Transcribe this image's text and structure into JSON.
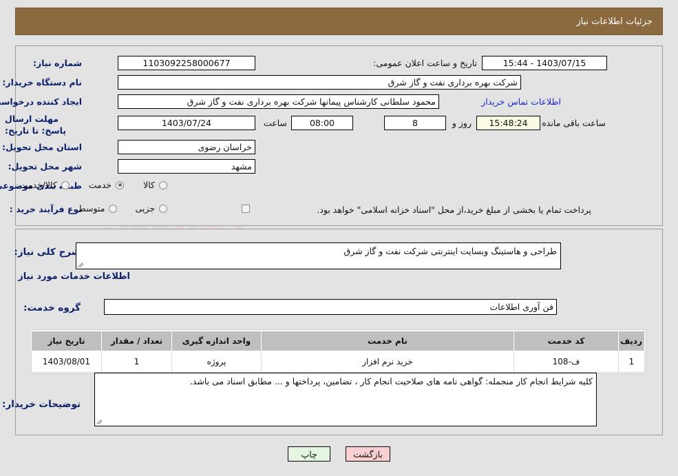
{
  "header": {
    "title": "جزئیات اطلاعات نیاز",
    "bar_color": "#8a6a3e"
  },
  "summary": {
    "need_number_label": "شماره نیاز:",
    "need_number_value": "1103092258000677",
    "announce_datetime_label": "تاریخ و ساعت اعلان عمومی:",
    "announce_datetime_value": "1403/07/15 - 15:44",
    "buyer_org_label": "نام دستگاه خریدار:",
    "buyer_org_value": "شرکت بهره برداری نفت و گاز شرق",
    "requester_label": "ایجاد کننده درخواست:",
    "requester_value": "محمود سلطانی کارشناس پیمانها شرکت بهره برداری نفت و گاز شرق",
    "contact_link": "اطلاعات تماس خریدار",
    "deadline_label": "مهلت ارسال پاسخ: تا تاریخ:",
    "deadline_date": "1403/07/24",
    "deadline_hour_label": "ساعت",
    "deadline_hour": "08:00",
    "days_remaining": "8",
    "days_unit_label": "روز و",
    "time_remaining": "15:48:24",
    "time_remaining_label": "ساعت باقی مانده",
    "province_label": "استان محل تحویل:",
    "province_value": "خراسان رضوی",
    "city_label": "شهر محل تحویل:",
    "city_value": "مشهد",
    "category_label": "طبقه بندی موضوعی:",
    "category_options": [
      {
        "label": "کالا",
        "checked": false
      },
      {
        "label": "خدمت",
        "checked": true
      },
      {
        "label": "کالا/خدمت",
        "checked": false
      }
    ],
    "process_type_label": "نوع فرآیند خرید :",
    "process_options": [
      {
        "label": "جزیی",
        "checked": false
      },
      {
        "label": "متوسط",
        "checked": false
      }
    ],
    "treasury_checkbox_checked": false,
    "treasury_note": "پرداخت تمام یا بخشی از مبلغ خرید،از محل \"اسناد خزانه اسلامی\" خواهد بود."
  },
  "details": {
    "general_desc_label": "شرح کلی نیاز:",
    "general_desc_value": "طراحی و هاستینگ وبسایت اینترنتی شرکت نفت و گاز شرق",
    "services_heading": "اطلاعات خدمات مورد نیاز",
    "service_group_label": "گروه خدمت:",
    "service_group_value": "فن آوری اطلاعات",
    "buyer_notes_label": "توضیحات خریدار:",
    "buyer_notes_value": "کلیه شرایط انجام کار منجمله: گواهی نامه های صلاحیت انجام کار ، تضامین، پرداختها و ... مطابق اسناد می باشد."
  },
  "items_table": {
    "columns": [
      "ردیف",
      "کد خدمت",
      "نام خدمت",
      "واحد اندازه گیری",
      "تعداد / مقدار",
      "تاریخ نیاز"
    ],
    "rows": [
      {
        "row_no": "1",
        "service_code": "ف-108",
        "service_name": "خرید نرم افزار",
        "unit": "پروژه",
        "quantity": "1",
        "need_date": "1403/08/01"
      }
    ]
  },
  "footer": {
    "print_label": "چاپ",
    "back_label": "بازگشت"
  },
  "watermark": {
    "text": "AriaTender.net"
  }
}
